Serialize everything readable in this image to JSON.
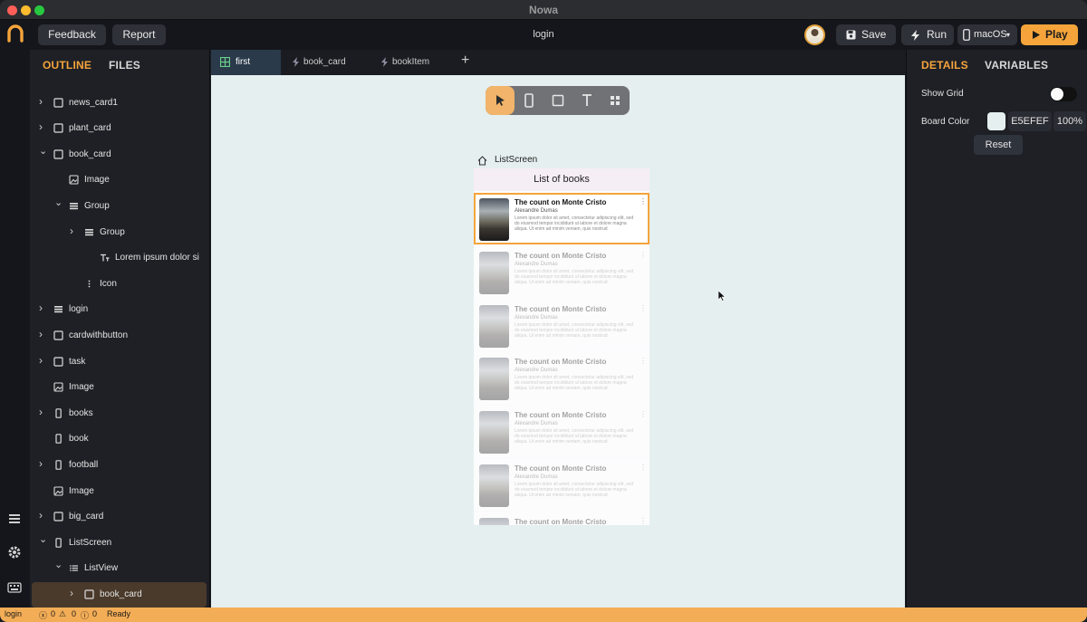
{
  "app_title": "Nowa",
  "toolbar": {
    "feedback_label": "Feedback",
    "report_label": "Report",
    "doc_title": "login",
    "save_label": "Save",
    "run_label": "Run",
    "platform_label": "macOS",
    "play_label": "Play"
  },
  "outline": {
    "tabs": [
      "OUTLINE",
      "FILES"
    ],
    "items": [
      {
        "label": "news_card1",
        "icon": "square-icon",
        "chevron": "right",
        "indent": 0
      },
      {
        "label": "plant_card",
        "icon": "square-icon",
        "chevron": "right",
        "indent": 0
      },
      {
        "label": "book_card",
        "icon": "square-icon",
        "chevron": "down",
        "indent": 0
      },
      {
        "label": "Image",
        "icon": "image-icon",
        "chevron": "none",
        "indent": 1
      },
      {
        "label": "Group",
        "icon": "rows-icon",
        "chevron": "down",
        "indent": 1
      },
      {
        "label": "Group",
        "icon": "rows-icon",
        "chevron": "right",
        "indent": 2
      },
      {
        "label": "Lorem ipsum dolor si",
        "icon": "text-icon",
        "chevron": "none",
        "indent": 3
      },
      {
        "label": "Icon",
        "icon": "more-vertical-icon",
        "chevron": "none",
        "indent": 2
      },
      {
        "label": "login",
        "icon": "rows-icon",
        "chevron": "right",
        "indent": 0
      },
      {
        "label": "cardwithbutton",
        "icon": "square-icon",
        "chevron": "right",
        "indent": 0
      },
      {
        "label": "task",
        "icon": "square-icon",
        "chevron": "right",
        "indent": 0
      },
      {
        "label": "Image",
        "icon": "image-icon",
        "chevron": "none",
        "indent": 0
      },
      {
        "label": "books",
        "icon": "phone-icon",
        "chevron": "right",
        "indent": 0
      },
      {
        "label": "book",
        "icon": "phone-icon",
        "chevron": "none",
        "indent": 0
      },
      {
        "label": "football",
        "icon": "phone-icon",
        "chevron": "right",
        "indent": 0
      },
      {
        "label": "Image",
        "icon": "image-icon",
        "chevron": "none",
        "indent": 0
      },
      {
        "label": "big_card",
        "icon": "square-icon",
        "chevron": "right",
        "indent": 0
      },
      {
        "label": "ListScreen",
        "icon": "phone-icon",
        "chevron": "down",
        "indent": 0
      },
      {
        "label": "ListView",
        "icon": "list-icon",
        "chevron": "down",
        "indent": 1
      },
      {
        "label": "book_card",
        "icon": "square-icon",
        "chevron": "right",
        "indent": 2,
        "selected": true
      }
    ]
  },
  "editor_tabs": [
    {
      "label": "first",
      "icon": "grid-icon",
      "active": true
    },
    {
      "label": "book_card",
      "icon": "bolt-icon",
      "active": false
    },
    {
      "label": "bookItem",
      "icon": "bolt-icon",
      "active": false
    }
  ],
  "canvas": {
    "screen_name": "ListScreen",
    "appbar_title": "List of books",
    "board_color": "#E5EFEF",
    "cards": [
      {
        "title": "The count on Monte Cristo",
        "author": "Alexandre Dumas",
        "desc": "Lorem ipsum dolor sit amet, consectetur adipiscing elit, sed do eiusmod tempor incididunt ut labore et dolore magna aliqua. Ut enim ad minim veniam, quis nostrud",
        "selected": true
      },
      {
        "title": "The count on Monte Cristo",
        "author": "Alexandre Dumas",
        "desc": "Lorem ipsum dolor sit amet, consectetur adipiscing elit, sed do eiusmod tempor incididunt ut labore et dolore magna aliqua. Ut enim ad minim veniam, quis nostrud",
        "selected": false
      },
      {
        "title": "The count on Monte Cristo",
        "author": "Alexandre Dumas",
        "desc": "Lorem ipsum dolor sit amet, consectetur adipiscing elit, sed do eiusmod tempor incididunt ut labore et dolore magna aliqua. Ut enim ad minim veniam, quis nostrud",
        "selected": false
      },
      {
        "title": "The count on Monte Cristo",
        "author": "Alexandre Dumas",
        "desc": "Lorem ipsum dolor sit amet, consectetur adipiscing elit, sed do eiusmod tempor incididunt ut labore et dolore magna aliqua. Ut enim ad minim veniam, quis nostrud",
        "selected": false
      },
      {
        "title": "The count on Monte Cristo",
        "author": "Alexandre Dumas",
        "desc": "Lorem ipsum dolor sit amet, consectetur adipiscing elit, sed do eiusmod tempor incididunt ut labore et dolore magna aliqua. Ut enim ad minim veniam, quis nostrud",
        "selected": false
      },
      {
        "title": "The count on Monte Cristo",
        "author": "Alexandre Dumas",
        "desc": "Lorem ipsum dolor sit amet, consectetur adipiscing elit, sed do eiusmod tempor incididunt ut labore et dolore magna aliqua. Ut enim ad minim veniam, quis nostrud",
        "selected": false
      },
      {
        "title": "The count on Monte Cristo",
        "author": "",
        "desc": "",
        "selected": false
      }
    ]
  },
  "details": {
    "tabs": [
      "DETAILS",
      "VARIABLES"
    ],
    "show_grid_label": "Show Grid",
    "show_grid_on": false,
    "board_color_label": "Board Color",
    "board_color_hex": "E5EFEF",
    "board_color_opacity": "100%",
    "reset_label": "Reset"
  },
  "status": {
    "file": "login",
    "errors": "0",
    "warnings": "0",
    "infos": "0",
    "state": "Ready"
  },
  "colors": {
    "accent": "#F5A43B",
    "canvas_bg": "#E5EFEF"
  }
}
